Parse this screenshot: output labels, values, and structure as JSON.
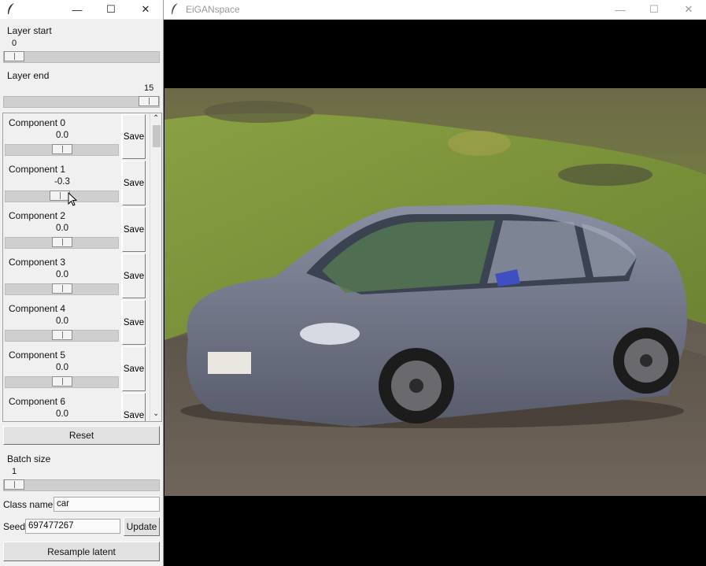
{
  "left_window": {
    "title_controls": {
      "minimize": "—",
      "maximize": "☐",
      "close": "✕"
    },
    "layer_start": {
      "label": "Layer start",
      "value": "0",
      "fraction": 0.0
    },
    "layer_end": {
      "label": "Layer end",
      "value": "15",
      "fraction": 1.0
    },
    "components": [
      {
        "name": "Component 0",
        "value": "0.0",
        "save": "Save",
        "fraction": 0.5
      },
      {
        "name": "Component 1",
        "value": "-0.3",
        "save": "Save",
        "fraction": 0.48
      },
      {
        "name": "Component 2",
        "value": "0.0",
        "save": "Save",
        "fraction": 0.5
      },
      {
        "name": "Component 3",
        "value": "0.0",
        "save": "Save",
        "fraction": 0.5
      },
      {
        "name": "Component 4",
        "value": "0.0",
        "save": "Save",
        "fraction": 0.5
      },
      {
        "name": "Component 5",
        "value": "0.0",
        "save": "Save",
        "fraction": 0.5
      },
      {
        "name": "Component 6",
        "value": "0.0",
        "save": "Save",
        "fraction": 0.5
      }
    ],
    "reset_label": "Reset",
    "batch_size": {
      "label": "Batch size",
      "value": "1",
      "fraction": 0.0
    },
    "class_name": {
      "label": "Class name",
      "value": "car"
    },
    "seed": {
      "label": "Seed",
      "value": "697477267"
    },
    "update_label": "Update",
    "resample_label": "Resample latent"
  },
  "viewer_window": {
    "title": "EiGANspace",
    "title_controls": {
      "minimize": "—",
      "maximize": "☐",
      "close": "✕"
    }
  }
}
